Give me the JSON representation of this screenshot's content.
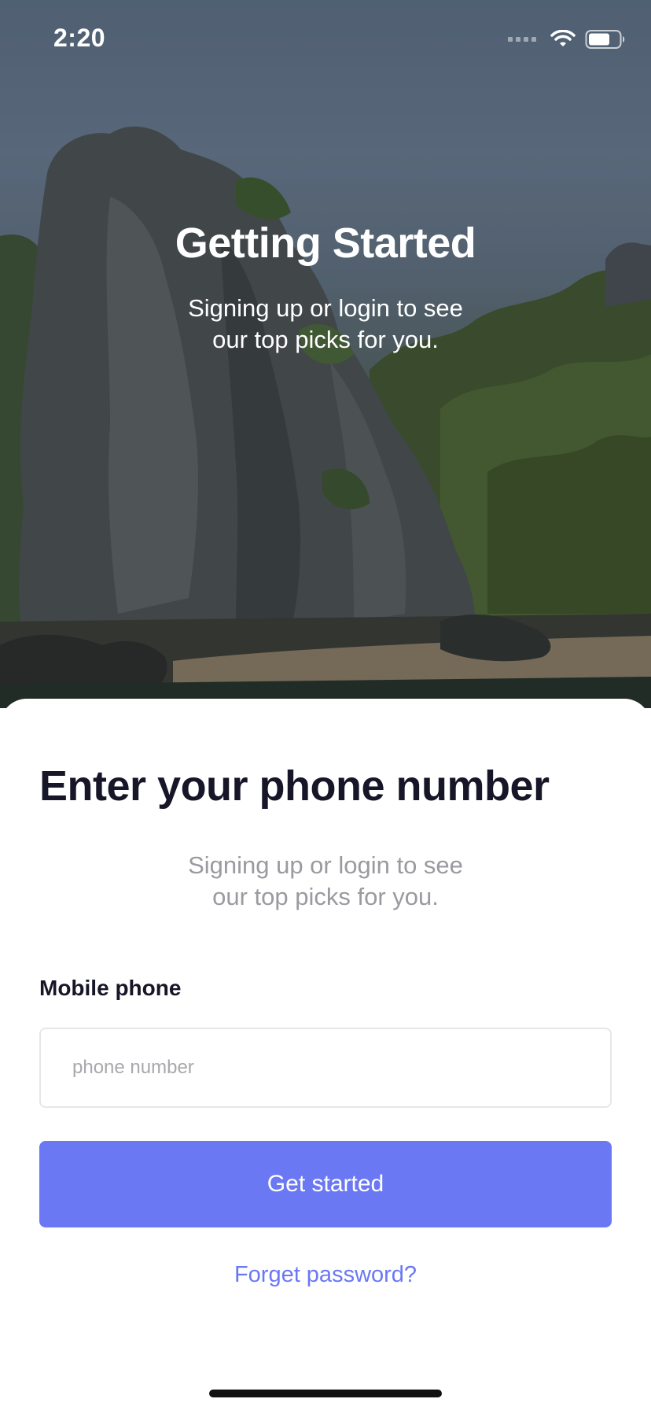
{
  "status_bar": {
    "time": "2:20"
  },
  "hero": {
    "title": "Getting Started",
    "subtitle": "Signing up or login to see our top picks for you."
  },
  "form": {
    "heading": "Enter your phone number",
    "subtitle": "Signing up or login to see our top picks for you.",
    "field_label": "Mobile phone",
    "phone_placeholder": "phone number",
    "phone_value": "",
    "submit_label": "Get started",
    "forgot_label": "Forget password?"
  },
  "colors": {
    "accent": "#6a78f4",
    "heading": "#161628",
    "muted": "#9a9aa0"
  },
  "icons": [
    "signal-icon",
    "wifi-icon",
    "battery-icon"
  ]
}
